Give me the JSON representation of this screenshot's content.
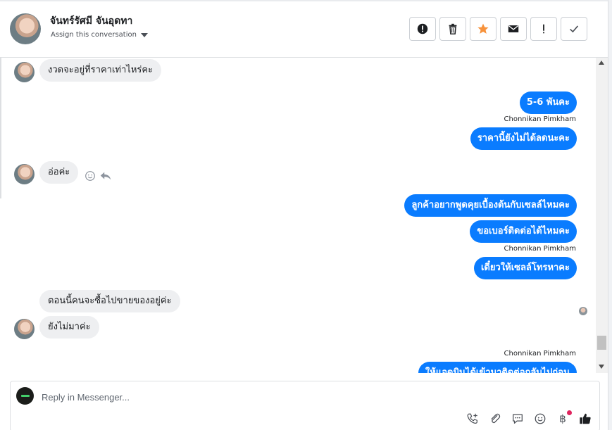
{
  "header": {
    "contact_name": "จันทร์รัศมี จันอุดทา",
    "assign_label": "Assign this conversation"
  },
  "actions": [
    {
      "icon": "alert-circle-icon",
      "label": "Mark as spam"
    },
    {
      "icon": "trash-icon",
      "label": "Delete"
    },
    {
      "icon": "star-icon",
      "label": "Star",
      "color": "#f7923b"
    },
    {
      "icon": "envelope-icon",
      "label": "Mark as unread"
    },
    {
      "icon": "exclamation-icon",
      "label": "Follow up"
    },
    {
      "icon": "checkmark-icon",
      "label": "Mark as done"
    }
  ],
  "messages": {
    "m1": "งวดจะอยู่ที่ราคาเท่าไหร่คะ",
    "m2": "5-6 พันคะ",
    "m2_sender": "Chonnikan Pimkham",
    "m3": "ราคานี้ยังไม่ได้ลดนะคะ",
    "m4": "อ่อค่ะ",
    "m5": "ลูกค้าอยากพูดคุยเบื้องต้นกับเซลล์ไหมคะ",
    "m6": "ขอเบอร์ติดต่อได้ไหมคะ",
    "m6_sender": "Chonnikan Pimkham",
    "m7": "เดี๋ยวให้เซลล์โทรหาคะ",
    "m8": "ตอนนี้คนจะซื้อไปขายของอยู่ค่ะ",
    "m9": "ยังไม่มาค่ะ",
    "m10_sender": "Chonnikan Pimkham",
    "m10_partial": "ให้แอดมินได้เข้ามาติดต่อกลับไปก่อน"
  },
  "composer": {
    "placeholder": "Reply in Messenger...",
    "tools": [
      "add-call-icon",
      "paperclip-icon",
      "saved-reply-icon",
      "emoji-icon",
      "baht-icon",
      "thumbs-up-icon"
    ],
    "baht_symbol": "฿"
  },
  "colors": {
    "outgoing_bubble": "#0a7cff",
    "incoming_bubble": "#eeeff1",
    "star": "#f7923b"
  }
}
